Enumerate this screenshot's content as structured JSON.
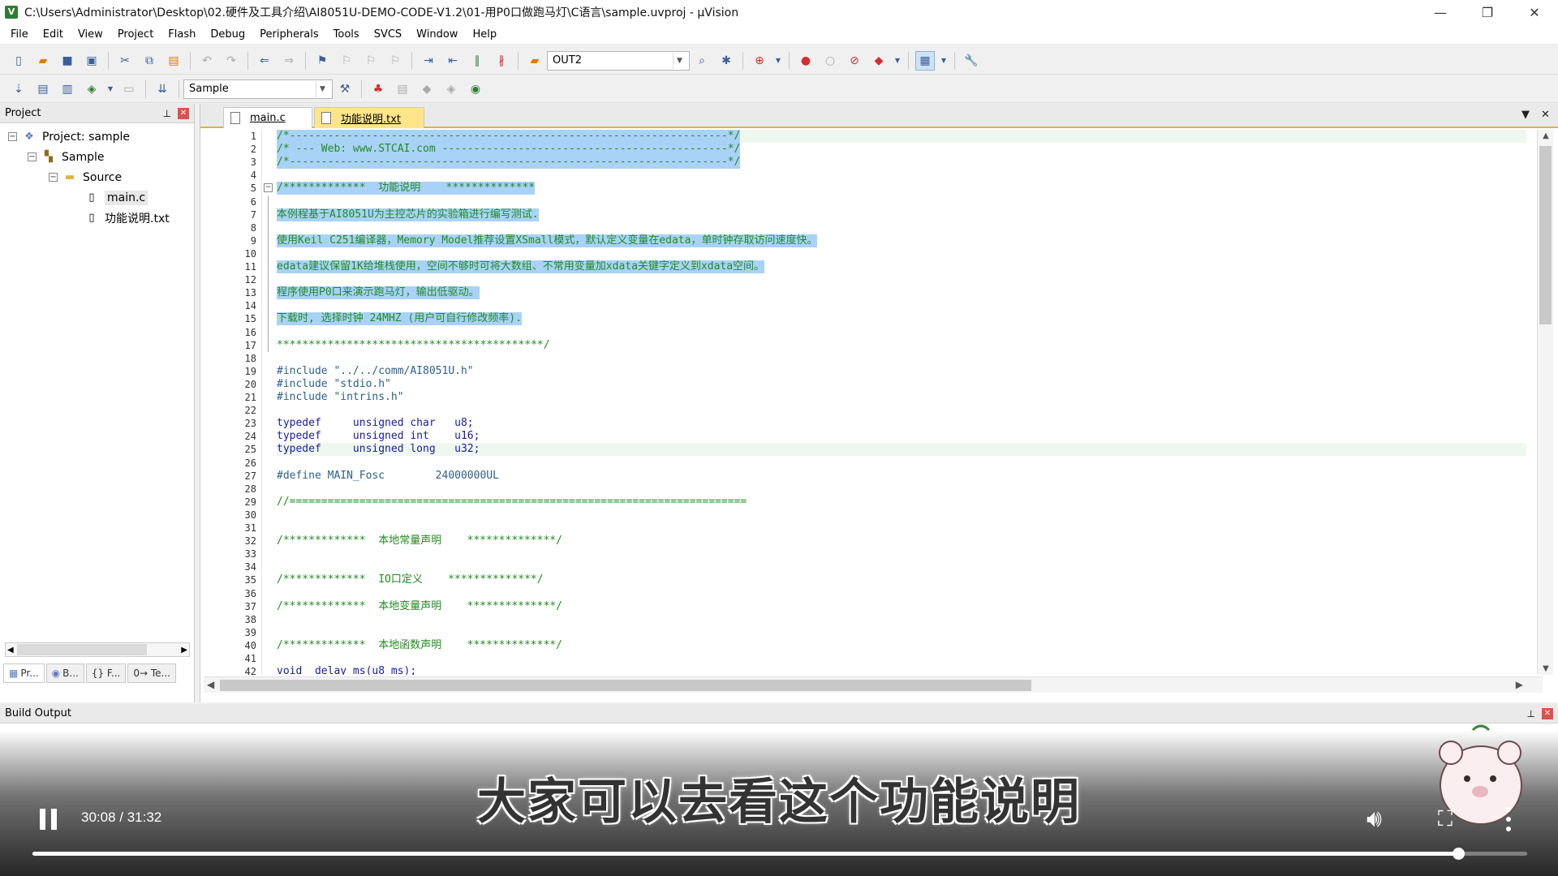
{
  "window": {
    "title": "C:\\Users\\Administrator\\Desktop\\02.硬件及工具介绍\\AI8051U-DEMO-CODE-V1.2\\01-用P0口做跑马灯\\C语言\\sample.uvproj - µVision",
    "minimize": "—",
    "restore": "❐",
    "close": "✕"
  },
  "menu": [
    "File",
    "Edit",
    "View",
    "Project",
    "Flash",
    "Debug",
    "Peripherals",
    "Tools",
    "SVCS",
    "Window",
    "Help"
  ],
  "toolbar": {
    "find_combo_value": "OUT2",
    "target_combo_value": "Sample"
  },
  "project_pane": {
    "header": "Project",
    "tree": {
      "root": "Project: sample",
      "target": "Sample",
      "group": "Source",
      "files": [
        "main.c",
        "功能说明.txt"
      ]
    },
    "bottom_tabs": [
      "Pr...",
      "B...",
      "{} F...",
      "0→ Te..."
    ]
  },
  "editor": {
    "tabs": [
      "main.c",
      "功能说明.txt"
    ],
    "line_numbers": [
      "1",
      "2",
      "3",
      "4",
      "5",
      "6",
      "7",
      "8",
      "9",
      "10",
      "11",
      "12",
      "13",
      "14",
      "15",
      "16",
      "17",
      "18",
      "19",
      "20",
      "21",
      "22",
      "23",
      "24",
      "25",
      "26",
      "27",
      "28",
      "29",
      "30",
      "31",
      "32",
      "33",
      "34",
      "35",
      "36",
      "37",
      "38",
      "39",
      "40",
      "41",
      "42"
    ],
    "lines": [
      "/*---------------------------------------------------------------------*/",
      "/* --- Web: www.STCAI.com ---------------------------------------------*/",
      "/*---------------------------------------------------------------------*/",
      "",
      "/*************  功能说明    **************",
      "",
      "本例程基于AI8051U为主控芯片的实验箱进行编写测试.",
      "",
      "使用Keil C251编译器，Memory Model推荐设置XSmall模式，默认定义变量在edata，单时钟存取访问速度快。",
      "",
      "edata建议保留1K给堆栈使用，空间不够时可将大数组、不常用变量加xdata关键字定义到xdata空间。",
      "",
      "程序使用P0口来演示跑马灯，输出低驱动。",
      "",
      "下载时, 选择时钟 24MHZ (用户可自行修改频率).",
      "",
      "******************************************/",
      "",
      "#include \"../../comm/AI8051U.h\"",
      "#include \"stdio.h\"",
      "#include \"intrins.h\"",
      "",
      "typedef     unsigned char   u8;",
      "typedef     unsigned int    u16;",
      "typedef     unsigned long   u32;",
      "",
      "#define MAIN_Fosc        24000000UL",
      "",
      "//========================================================================",
      "",
      "",
      "/*************  本地常量声明    **************/",
      "",
      "",
      "/*************  IO口定义    **************/",
      "",
      "/*************  本地变量声明    **************/",
      "",
      "",
      "/*************  本地函数声明    **************/",
      "",
      "void  delay_ms(u8 ms);"
    ]
  },
  "build_output": {
    "header": "Build Output"
  },
  "video": {
    "subtitle": "大家可以去看这个功能说明",
    "time": "30:08 / 31:32",
    "progress": 0.954
  }
}
